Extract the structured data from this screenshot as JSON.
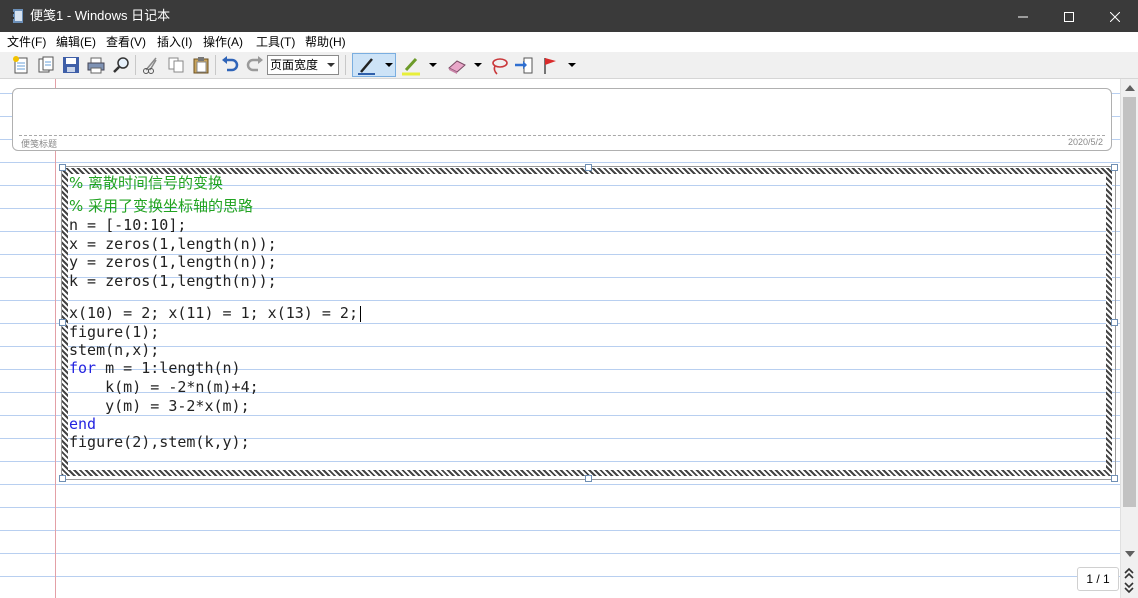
{
  "window": {
    "title": "便笺1 - Windows 日记本",
    "minimize": "—",
    "maximize": "☐",
    "close": "✕"
  },
  "menu": [
    "文件(F)",
    "编辑(E)",
    "查看(V)",
    "插入(I)",
    "操作(A)",
    "工具(T)",
    "帮助(H)"
  ],
  "toolbar": {
    "zoom_value": "页面宽度",
    "icons": [
      "new-note-icon",
      "new-page-icon",
      "save-icon",
      "print-icon",
      "find-icon",
      "cut-icon",
      "copy-icon",
      "paste-icon",
      "undo-icon",
      "redo-icon",
      "pen-icon",
      "highlighter-icon",
      "eraser-icon",
      "lasso-icon",
      "insert-space-icon",
      "flag-icon"
    ]
  },
  "note": {
    "title_placeholder": "便笺标题",
    "date": "2020/5/2"
  },
  "code": [
    "% 离散时间信号的变换",
    "% 采用了变换坐标轴的思路",
    "n = [-10:10];",
    "x = zeros(1,length(n));",
    "y = zeros(1,length(n));",
    "k = zeros(1,length(n));",
    "",
    "x(10) = 2; x(11) = 1; x(13) = 2;",
    "figure(1);",
    "stem(n,x);",
    "for m = 1:length(n)",
    "    k(m) = -2*n(m)+4;",
    "    y(m) = 3-2*x(m);",
    "end",
    "figure(2),stem(k,y);"
  ],
  "pager": "1 / 1",
  "colors": {
    "comment": "#21a321",
    "keyword": "#2424e0",
    "ruled_line": "#b8cff0",
    "margin_line": "#e3a0a6",
    "titlebar": "#3a3a3a"
  }
}
